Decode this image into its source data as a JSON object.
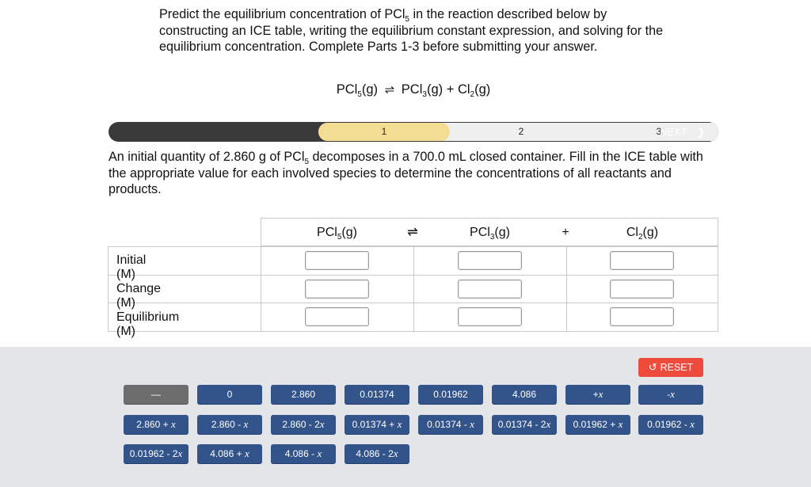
{
  "prompt": {
    "part1": "Predict the equilibrium concentration of PCl",
    "sub1": "5",
    "part2": " in the reaction described below by constructing an ICE table, writing the equilibrium constant expression, and solving for the equilibrium concentration. Complete Parts 1-3 before submitting your answer."
  },
  "equation": {
    "r1": "PCl",
    "r1sub": "5",
    "r1state": "(g)",
    "arrow": "⇌",
    "p1": "PCl",
    "p1sub": "3",
    "p1state": "(g)",
    "plus": "+",
    "p2": "Cl",
    "p2sub": "2",
    "p2state": "(g)"
  },
  "progress": {
    "steps": [
      "1",
      "2",
      "3"
    ],
    "current_step": 1,
    "next_label": "NEXT",
    "next_icon": "chevron-right-icon"
  },
  "intro": {
    "a": "An initial quantity of 2.860 g of PCl",
    "sub": "5",
    "b": " decomposes in a 700.0 mL closed container. Fill in the ICE table with the appropriate value for each involved species to determine the concentrations of all reactants and products."
  },
  "table": {
    "headers": [
      {
        "f": "PCl",
        "sub": "5",
        "st": "(g)"
      },
      {
        "f": "⇌",
        "sub": "",
        "st": ""
      },
      {
        "f": "PCl",
        "sub": "3",
        "st": "(g)"
      },
      {
        "f": "+",
        "sub": "",
        "st": ""
      },
      {
        "f": "Cl",
        "sub": "2",
        "st": "(g)"
      }
    ],
    "rows": [
      "Initial (M)",
      "Change (M)",
      "Equilibrium (M)"
    ],
    "inputs": [
      [
        "",
        "",
        ""
      ],
      [
        "",
        "",
        ""
      ],
      [
        "",
        "",
        ""
      ]
    ]
  },
  "palette": {
    "reset_label": "RESET",
    "reset_icon": "undo-icon",
    "tiles": [
      [
        "—",
        "0",
        "2.860",
        "0.01374",
        "0.01962",
        "4.086",
        "+x",
        "-x"
      ],
      [
        "2.860 + x",
        "2.860 - x",
        "2.860 - 2x",
        "0.01374 + x",
        "0.01374 - x",
        "0.01374 - 2x",
        "0.01962 + x",
        "0.01962 - x"
      ],
      [
        "0.01962 - 2x",
        "4.086 + x",
        "4.086 - x",
        "4.086 - 2x"
      ]
    ]
  }
}
